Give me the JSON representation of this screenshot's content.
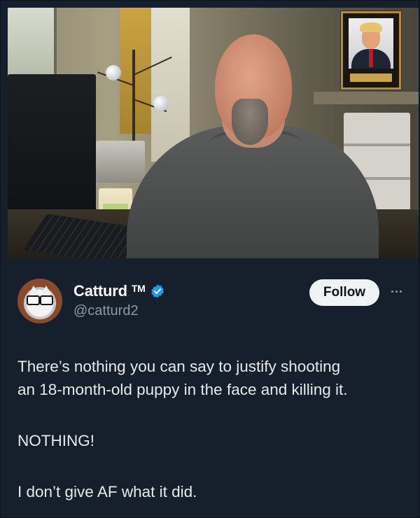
{
  "tweet": {
    "author": {
      "display_name": "Catturd",
      "trademark": "TM",
      "handle": "@catturd2",
      "verified": true,
      "verified_color": "#1d9bf0"
    },
    "follow_label": "Follow",
    "more_icon": "more-horizontal-icon",
    "text": {
      "line1": "There’s nothing you can say to justify shooting",
      "line2": "an 18-month-old puppy in the face and killing it.",
      "line3": "NOTHING!",
      "line4": "I don’t give AF what it did."
    }
  },
  "colors": {
    "background": "#16202d",
    "text": "#e7e9ea",
    "secondary_text": "#8b98a5",
    "follow_button_bg": "#eff3f4"
  }
}
